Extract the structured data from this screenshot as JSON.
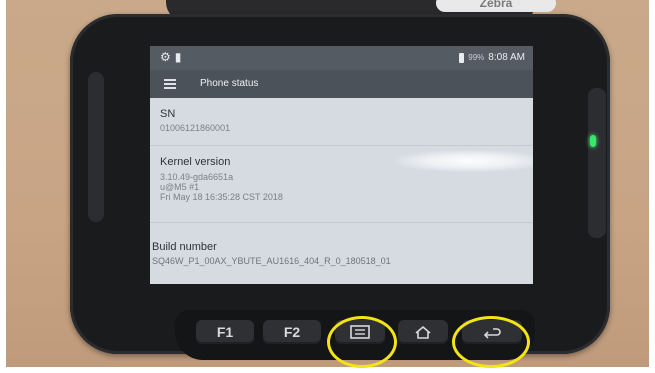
{
  "strap": {
    "label": "Zebra"
  },
  "statusbar": {
    "left_icons": [
      "settings-icon",
      "sim-card-icon"
    ],
    "battery": "99%",
    "time": "8:08 AM"
  },
  "appbar": {
    "title": "Phone status"
  },
  "rows": [
    {
      "title": "SN",
      "values": [
        "01006121860001"
      ]
    },
    {
      "title": "Kernel version",
      "values": [
        "3.10.49-gda6651a",
        "u@M5 #1",
        "Fri May 18 16:35:28 CST 2018"
      ]
    },
    {
      "title": "Build number",
      "values": [
        "SQ46W_P1_00AX_YBUTE_AU1616_404_R_0_180518_01"
      ]
    }
  ],
  "hardware_keys": {
    "f1": "F1",
    "f2": "F2",
    "menu": "menu-icon",
    "home": "home-icon",
    "back": "back-icon"
  },
  "highlight_color": "#f3e414",
  "led_color": "#38e86a"
}
